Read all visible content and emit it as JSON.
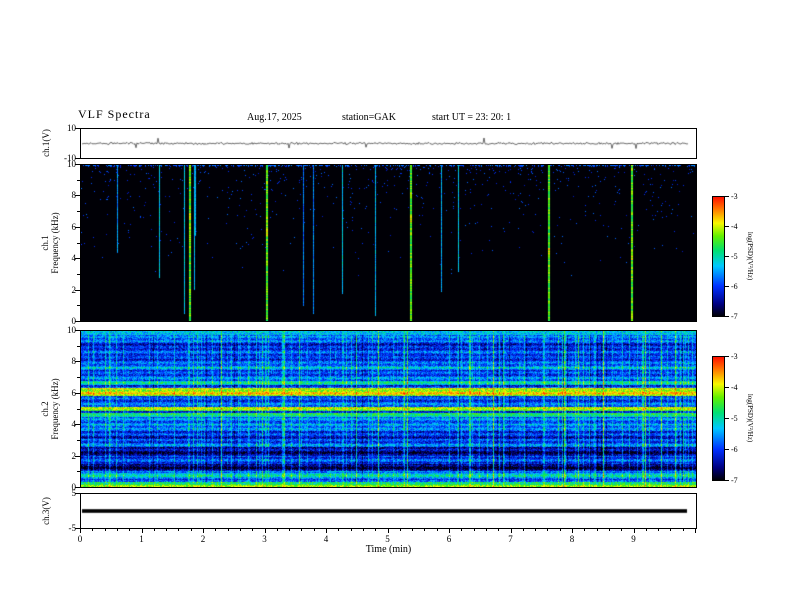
{
  "header": {
    "title": "VLF  Spectra",
    "date": "Aug.17, 2025",
    "station": "station=GAK",
    "start_ut": "start UT  =   23: 20: 1"
  },
  "x_axis": {
    "label": "Time  (min)",
    "min": 0,
    "max": 10,
    "major_ticks": [
      0,
      1,
      2,
      3,
      4,
      5,
      6,
      7,
      8,
      9
    ],
    "minor_step": 0.2
  },
  "panels": {
    "ch1v": {
      "name": "ch.1(V)",
      "ymin": -10,
      "ymax": 10,
      "ytick_labels": [
        "10",
        "-10"
      ]
    },
    "spec1": {
      "name_line1": "ch.1",
      "name_line2": "Frequency  (kHz)",
      "ymin": 0,
      "ymax": 10,
      "ytick_labels": [
        "10",
        "8",
        "6",
        "4",
        "2",
        "0"
      ]
    },
    "spec2": {
      "name_line1": "ch.2",
      "name_line2": "Frequency  (kHz)",
      "ymin": 0,
      "ymax": 10,
      "ytick_labels": [
        "10",
        "8",
        "6",
        "4",
        "2",
        "0"
      ]
    },
    "ch3v": {
      "name": "ch.3(V)",
      "ymin": -5,
      "ymax": 5,
      "ytick_labels": [
        "5",
        "-5"
      ]
    }
  },
  "colorbar": {
    "label": "log(PSD)(V²/Hz)",
    "tick_labels": [
      "-3",
      "-4",
      "-5",
      "-6",
      "-7"
    ],
    "range_top": -3,
    "range_bottom": -7,
    "gradient": [
      {
        "pos": 0.0,
        "color": "#000006"
      },
      {
        "pos": 0.1,
        "color": "#000080"
      },
      {
        "pos": 0.25,
        "color": "#0030ff"
      },
      {
        "pos": 0.42,
        "color": "#00c8ff"
      },
      {
        "pos": 0.55,
        "color": "#00e070"
      },
      {
        "pos": 0.67,
        "color": "#60f000"
      },
      {
        "pos": 0.78,
        "color": "#f8f800"
      },
      {
        "pos": 0.89,
        "color": "#ff8000"
      },
      {
        "pos": 1.0,
        "color": "#ff1000"
      }
    ]
  },
  "chart_data": [
    {
      "panel": "ch.1(V)",
      "type": "line",
      "x_axis": "Time (min)",
      "x_range": [
        0,
        10
      ],
      "y_unit": "V",
      "y_range": [
        -10,
        10
      ],
      "summary": "thin noisy waveform centered on 0 V with sporadic small spikes, roughly constant over the full 10 minutes"
    },
    {
      "panel": "ch.1 spectrogram",
      "type": "heatmap",
      "x_range": [
        0,
        10
      ],
      "y_unit": "kHz",
      "y_range": [
        0,
        10
      ],
      "z_label": "log(PSD)(V²/Hz)",
      "z_range": [
        -7,
        -3
      ],
      "background_level": -7.2,
      "features": {
        "description": "mostly black (below -7) with dense faint blue sferic streaks descending from 10 kHz, sparse blue speckle, and a few bright green full-height vertical lines",
        "bright_line_times_min": [
          1.75,
          3.0,
          5.35,
          7.6,
          8.95
        ],
        "bright_line_level": -4.4,
        "faint_streak_level": -6.3,
        "top_edge_speckle_level": -6.0
      }
    },
    {
      "panel": "ch.2 spectrogram",
      "type": "heatmap",
      "x_range": [
        0,
        10
      ],
      "y_unit": "kHz",
      "y_range": [
        0,
        10
      ],
      "z_label": "log(PSD)(V²/Hz)",
      "z_range": [
        -7,
        -3
      ],
      "background_level": -5.85,
      "features": {
        "description": "continuous blue/cyan noise with bright green-yellow horizontal bands near 5-6.3 kHz, dark horizontal bands near 1.2, 2.3 and 3.4 kHz, and frequent bright green vertical streaks at irregular times",
        "bands": [
          {
            "f0": 5.85,
            "f1": 6.35,
            "level": -4.1
          },
          {
            "f0": 4.9,
            "f1": 5.15,
            "level": -4.35
          },
          {
            "f0": 4.5,
            "f1": 4.75,
            "level": -4.8
          },
          {
            "f0": 6.55,
            "f1": 6.8,
            "level": -5.15
          },
          {
            "f0": 0.0,
            "f1": 0.35,
            "level": -4.6
          },
          {
            "f0": 0.55,
            "f1": 0.95,
            "level": -5.3
          },
          {
            "f0": 3.75,
            "f1": 4.05,
            "level": -5.45
          },
          {
            "f0": 7.55,
            "f1": 7.75,
            "level": -5.5
          },
          {
            "f0": 1.05,
            "f1": 1.5,
            "level": -6.6
          },
          {
            "f0": 1.6,
            "f1": 1.95,
            "level": -6.1
          },
          {
            "f0": 2.05,
            "f1": 2.6,
            "level": -6.5
          },
          {
            "f0": 3.1,
            "f1": 3.6,
            "level": -6.2
          },
          {
            "f0": 8.3,
            "f1": 9.3,
            "level": -6.05
          }
        ],
        "vertical_streak_boost": [
          0.4,
          1.6
        ]
      }
    },
    {
      "panel": "ch.3(V)",
      "type": "line",
      "x_range": [
        0,
        10
      ],
      "y_unit": "V",
      "y_range": [
        -5,
        5
      ],
      "summary": "constant thick flat trace at 0 V for the full 10 minutes"
    }
  ]
}
